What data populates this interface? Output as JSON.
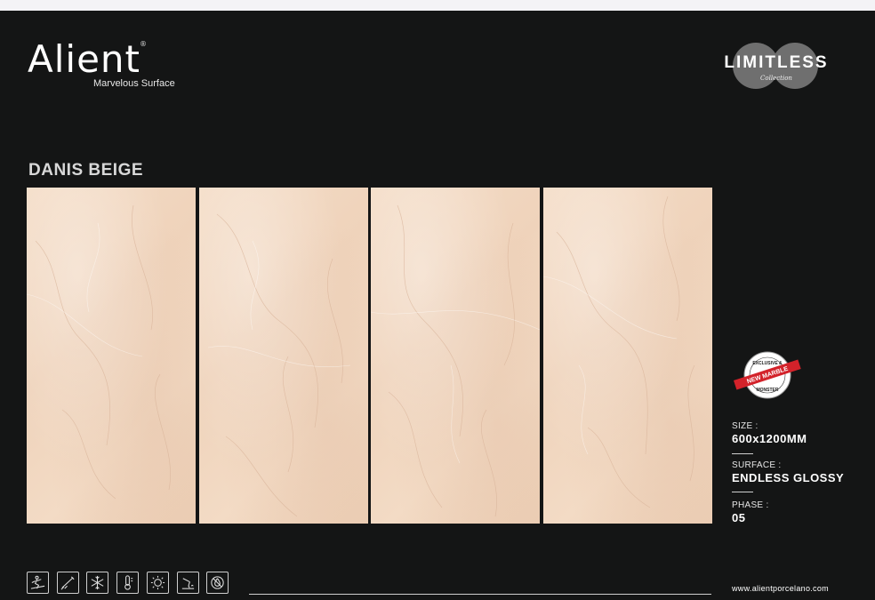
{
  "brand": {
    "name": "Alient",
    "registered": "®",
    "tagline": "Marvelous Surface"
  },
  "collection": {
    "title": "LIMITLESS",
    "subtitle": "Collection"
  },
  "product": {
    "name": "DANIS BEIGE"
  },
  "tiles": {
    "count": 4,
    "color": "#f1d8c2"
  },
  "badge": {
    "top_text": "EXCLUSIVE &",
    "ribbon_text": "NEW MARBLE",
    "bottom_text": "MONSTER",
    "ribbon_color": "#d3222a"
  },
  "specs": [
    {
      "label": "SIZE :",
      "value": "600x1200MM"
    },
    {
      "label": "SURFACE :",
      "value": "ENDLESS GLOSSY"
    },
    {
      "label": "PHASE :",
      "value": "05"
    }
  ],
  "feature_icons": [
    "anti-slip-icon",
    "scratch-resistant-icon",
    "frost-resistant-icon",
    "heat-resistant-icon",
    "uv-resistant-icon",
    "chemical-resistant-icon",
    "no-water-absorption-icon"
  ],
  "footer": {
    "website": "www.alientporcelano.com"
  },
  "colors": {
    "background": "#141515",
    "text": "#ffffff",
    "tile": "#f1d8c2",
    "badge_red": "#d3222a"
  }
}
